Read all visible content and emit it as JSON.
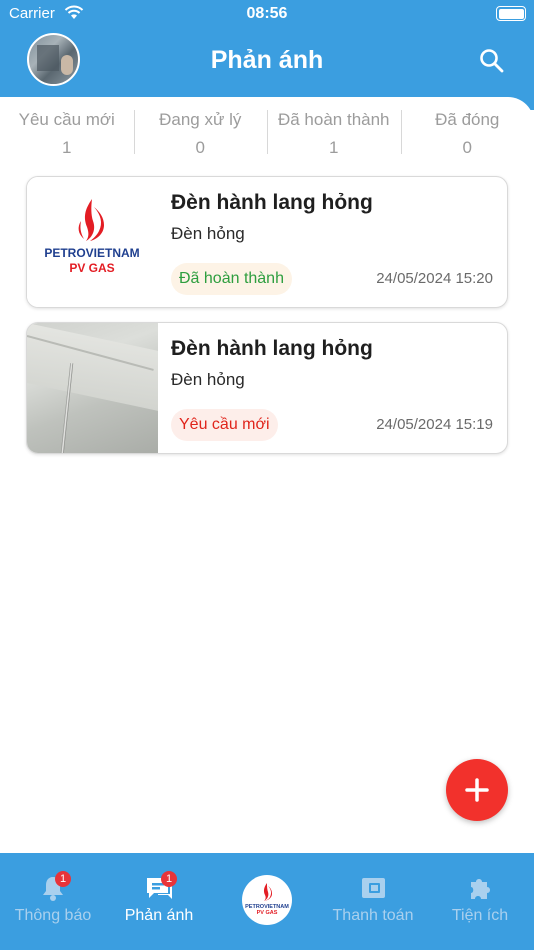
{
  "status_bar": {
    "carrier": "Carrier",
    "time": "08:56"
  },
  "header": {
    "title": "Phản ánh"
  },
  "stats": [
    {
      "label": "Yêu cầu mới",
      "count": "1"
    },
    {
      "label": "Đang xử lý",
      "count": "0"
    },
    {
      "label": "Đã hoàn thành",
      "count": "1"
    },
    {
      "label": "Đã đóng",
      "count": "0"
    }
  ],
  "cards": [
    {
      "title": "Đèn hành lang hỏng",
      "desc": "Đèn hỏng",
      "status": "Đã hoàn thành",
      "time": "24/05/2024 15:20",
      "thumbnail": "petrovietnam-pv-gas-logo"
    },
    {
      "title": "Đèn hành lang hỏng",
      "desc": "Đèn hỏng",
      "status": "Yêu cầu mới",
      "time": "24/05/2024 15:19",
      "thumbnail": "ceiling-photo"
    }
  ],
  "logo": {
    "line1": "PETROVIETNAM",
    "line2": "PV GAS"
  },
  "nav": [
    {
      "label": "Thông báo",
      "badge": "1",
      "icon": "bell-icon"
    },
    {
      "label": "Phản ánh",
      "badge": "1",
      "icon": "chat-icon"
    },
    {
      "label": "Thanh toán",
      "icon": "wallet-icon"
    },
    {
      "label": "Tiện ích",
      "icon": "puzzle-icon"
    }
  ],
  "colors": {
    "primary": "#3b9ee0",
    "fab": "#f2312c",
    "done": "#2e9e3f",
    "new": "#e0241b"
  }
}
